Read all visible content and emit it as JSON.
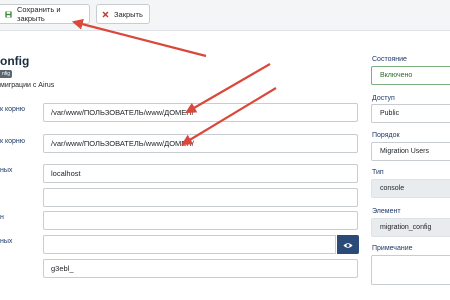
{
  "toolbar": {
    "save_close_label": "Сохранить и закрыть",
    "close_label": "Закрыть",
    "save_icon": "floppy-disk-icon",
    "close_icon": "x-icon"
  },
  "header": {
    "title": "onfig",
    "badge": "nfig",
    "description": "миграции с Airus"
  },
  "form": {
    "fields": [
      {
        "label": "к корню",
        "value": "/var/www/ПОЛЬЗОВАТЕЛЬ/www/ДОМЕН/"
      },
      {
        "label": "к корню",
        "value": "/var/www/ПОЛЬЗОВАТЕЛЬ/www/ДОМЕН/"
      },
      {
        "label": "ных",
        "value": "localhost"
      },
      {
        "label": "",
        "value": ""
      },
      {
        "label": "н",
        "value": ""
      },
      {
        "label": "ных",
        "value": ""
      },
      {
        "label": "",
        "value": "g3ebl_"
      }
    ],
    "password_toggle_icon": "eye-icon"
  },
  "sidebar": {
    "state": {
      "label": "Состояние",
      "value": "Включено"
    },
    "access": {
      "label": "Доступ",
      "value": "Public"
    },
    "order": {
      "label": "Порядок",
      "value": "Migration Users"
    },
    "type": {
      "label": "Тип",
      "value": "console"
    },
    "element": {
      "label": "Элемент",
      "value": "migration_config"
    },
    "note": {
      "label": "Примечание",
      "value": ""
    }
  },
  "colors": {
    "annotation_arrow": "#d9483b",
    "label_blue": "#1f3a6a",
    "eye_button": "#2a4a78",
    "save_icon_green": "#3a8a3a",
    "close_icon_red": "#c0392b"
  }
}
